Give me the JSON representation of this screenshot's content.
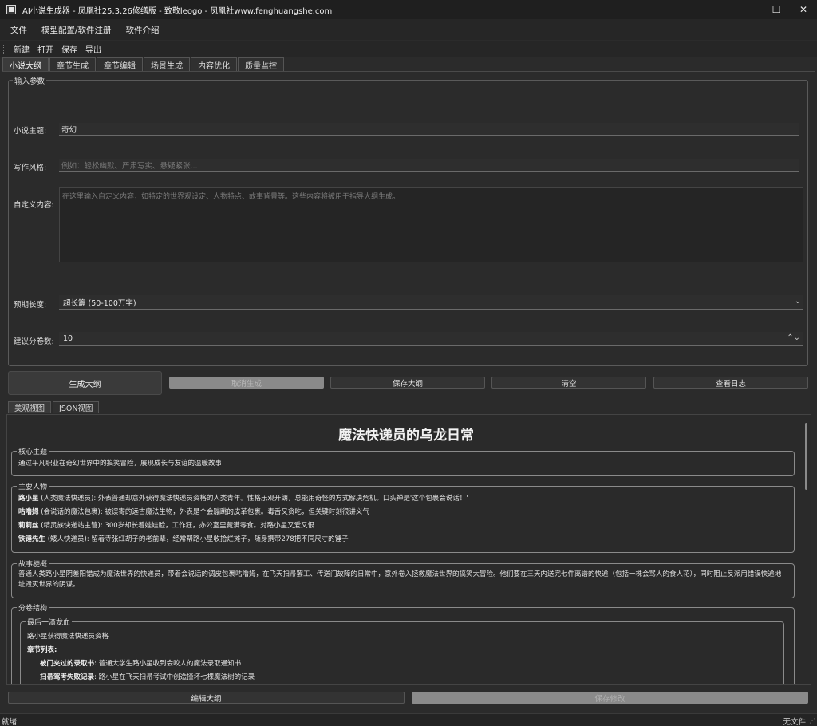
{
  "window": {
    "title": "AI小说生成器 - 凤凰社25.3.26修缮版 - 致敬leogo - 凤凰社www.fenghuangshe.com",
    "minimize_glyph": "—",
    "maximize_glyph": "☐",
    "close_glyph": "✕"
  },
  "menubar": {
    "items": [
      "文件",
      "模型配置/软件注册",
      "软件介绍"
    ]
  },
  "toolbar": {
    "items": [
      "新建",
      "打开",
      "保存",
      "导出"
    ]
  },
  "tabs": [
    "小说大纲",
    "章节生成",
    "章节编辑",
    "场景生成",
    "内容优化",
    "质量监控"
  ],
  "input_group": {
    "title": "输入参数",
    "theme_label": "小说主题:",
    "theme_value": "奇幻",
    "style_label": "写作风格:",
    "style_placeholder": "例如：轻松幽默、严肃写实、悬疑紧张...",
    "custom_label": "自定义内容:",
    "custom_placeholder": "在这里输入自定义内容，如特定的世界观设定、人物特点、故事背景等。这些内容将被用于指导大纲生成。",
    "length_label": "预期长度:",
    "length_value": "超长篇 (50-100万字)",
    "volumes_label": "建议分卷数:",
    "volumes_value": "10"
  },
  "actions": {
    "generate": "生成大纲",
    "cancel": "取消生成",
    "save": "保存大纲",
    "clear": "清空",
    "log": "查看日志"
  },
  "view_tabs": [
    "美观视图",
    "JSON视图"
  ],
  "outline": {
    "title": "魔法快递员的乌龙日常",
    "core_theme_title": "核心主题",
    "core_theme": "通过平凡职业在奇幻世界中的搞笑冒险，展现成长与友谊的温暖故事",
    "characters_title": "主要人物",
    "characters": [
      {
        "name": "路小星",
        "desc": " (人类魔法快递员): 外表普通却意外获得魔法快递员资格的人类青年。性格乐观开朗，总能用奇怪的方式解决危机。口头禅是'这个包裹会说话！'"
      },
      {
        "name": "咕噜姆",
        "desc": " (会说话的魔法包裹): 被误寄的远古魔法生物，外表是个会蹦跳的皮革包裹。毒舌又贪吃，但关键时刻很讲义气"
      },
      {
        "name": "莉莉丝",
        "desc": " (精灵族快递站主管): 300岁却长着娃娃脸，工作狂，办公室里藏满零食。对路小星又爱又恨"
      },
      {
        "name": "铁锤先生",
        "desc": " (矮人快递员): 留着寺张红胡子的老前辈，经常帮路小星收拾烂摊子，随身携带278把不同尺寸的锤子"
      }
    ],
    "synopsis_title": "故事梗概",
    "synopsis": "普通人类路小星阴差阳错成为魔法世界的快递员，带着会说话的调皮包裹咕噜姆，在飞天扫帚罢工、传送门故障的日常中，意外卷入拯救魔法世界的搞笑大冒险。他们要在三天内送完七件离谱的快递（包括一株会骂人的食人花），同时阻止反派用错误快递地址毁灭世界的阴谋。",
    "volumes_title": "分卷结构",
    "volume1_title": "最后一滴龙血",
    "volume1_desc": "路小星获得魔法快递员资格",
    "chapter_list_label": "章节列表:",
    "chapters": [
      {
        "name": "被门夹过的录取书",
        "desc": ": 普通大学生路小星收到会咬人的魔法录取通知书"
      },
      {
        "name": "扫帚驾考失败记录",
        "desc": ": 路小星在飞天扫帚考试中创造撞坏七棵魔法树的记录"
      }
    ]
  },
  "bottom": {
    "edit": "编辑大纲",
    "save_changes": "保存修改"
  },
  "status": {
    "left": "就绪",
    "right": "无文件",
    "grip": "⋰"
  }
}
